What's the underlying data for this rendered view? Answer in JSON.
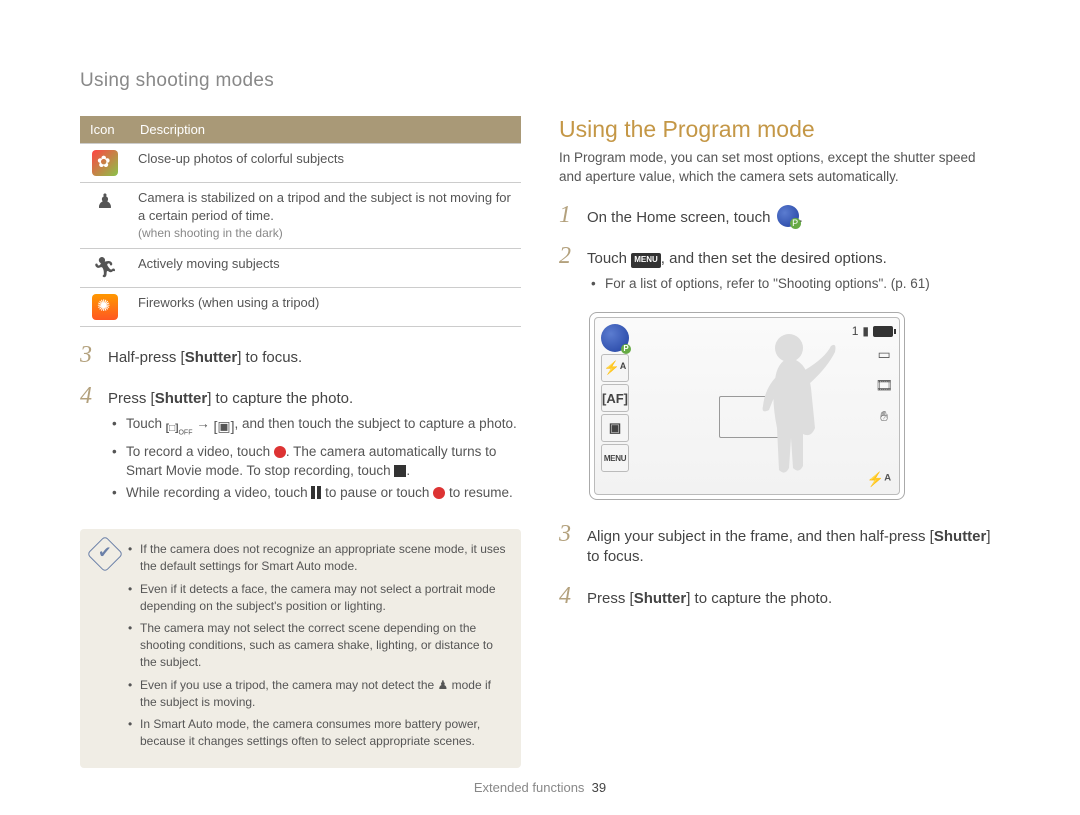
{
  "section_title": "Using shooting modes",
  "icon_table": {
    "headers": {
      "icon": "Icon",
      "description": "Description"
    },
    "rows": [
      {
        "icon_name": "flower-closeup-icon",
        "desc": "Close-up photos of colorful subjects"
      },
      {
        "icon_name": "tripod-icon",
        "desc": "Camera is stabilized on a tripod and the subject is not moving for a certain period of time.",
        "hint": "(when shooting in the dark)"
      },
      {
        "icon_name": "action-icon",
        "desc": "Actively moving subjects"
      },
      {
        "icon_name": "fireworks-icon",
        "desc": "Fireworks (when using a tripod)"
      }
    ]
  },
  "left_steps": {
    "step3": {
      "part1": "Half-press [",
      "bold": "Shutter",
      "part3": "] to focus."
    },
    "step4": {
      "part1": "Press [",
      "bold": "Shutter",
      "part3": "] to capture the photo.",
      "sub": [
        {
          "a": "Touch ",
          "icon1": "touch-off-icon",
          "b": " → ",
          "icon2": "touch-tap-icon",
          "c": ", and then touch the subject to capture a photo."
        },
        {
          "a": "To record a video, touch ",
          "icon1": "record-icon",
          "b": ". The camera automatically turns to Smart Movie mode. To stop recording, touch ",
          "icon2": "stop-icon",
          "c": "."
        },
        {
          "a": "While recording a video, touch ",
          "icon1": "pause-icon",
          "b": " to pause or touch ",
          "icon2": "record-icon",
          "c": " to resume."
        }
      ]
    }
  },
  "notes": [
    "If the camera does not recognize an appropriate scene mode, it uses the default settings for Smart Auto mode.",
    "Even if it detects a face, the camera may not select a portrait mode depending on the subject's position or lighting.",
    "The camera may not select the correct scene depending on the shooting conditions, such as camera shake, lighting, or distance to the subject.",
    {
      "a": "Even if you use a tripod, the camera may not detect the ",
      "icon": "tripod-icon-small",
      "c": " mode if the subject is moving."
    },
    "In Smart Auto mode, the camera consumes more battery power, because it changes settings often to select appropriate scenes."
  ],
  "program": {
    "title": "Using the Program mode",
    "intro": "In Program mode, you can set most options, except the shutter speed and aperture value, which the camera sets automatically.",
    "step1": {
      "a": "On the Home screen, touch ",
      "icon": "program-mode-icon",
      "c": "."
    },
    "step2": {
      "a": "Touch ",
      "menu_label": "MENU",
      "c": ", and then set the desired options.",
      "sub": "For a list of options, refer to \"Shooting options\". (p. 61)"
    },
    "step3": {
      "a": "Align your subject in the frame, and then half-press [",
      "bold": "Shutter",
      "c": "] to focus."
    },
    "step4": {
      "a": "Press [",
      "bold": "Shutter",
      "c": "] to capture the photo."
    }
  },
  "viewfinder": {
    "left_icons": [
      "program-mode-icon",
      "flash-auto-icon",
      "af-icon",
      "shooting-mode-icon",
      "menu-icon"
    ],
    "left_labels": {
      "flash": "⚡ᴬ",
      "af": "[AF]",
      "shot": "▣",
      "menu": "MENU"
    },
    "top_right_count": "1",
    "right_icons": [
      "photo-icon",
      "video-icon",
      "stabilizer-icon"
    ],
    "bottom_right": "⚡ᴬ"
  },
  "footer": {
    "section": "Extended functions",
    "page": "39"
  }
}
